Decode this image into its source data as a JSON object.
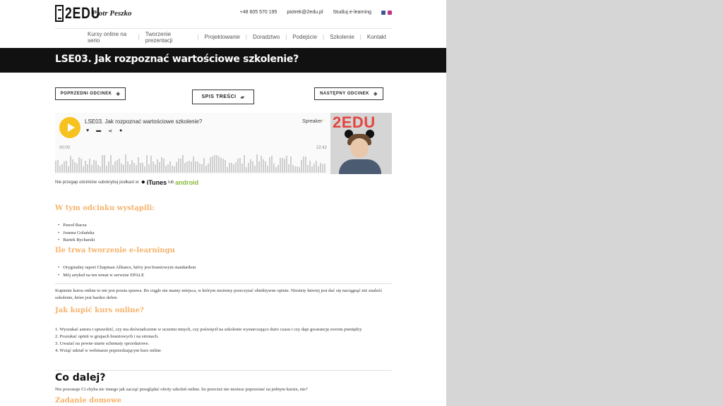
{
  "header": {
    "logo": "2EDU",
    "author": "Piotr Peszko",
    "phone": "+48 605 570 195",
    "email": "piotrek@2edu.pl",
    "study_link": "Studiuj e-learning"
  },
  "nav": [
    "Kursy online na serio",
    "Tworzenie prezentacji",
    "Projektowanie",
    "Doradztwo",
    "Podejście",
    "Szkolenie",
    "Kontakt"
  ],
  "page_title": "LSE03. Jak rozpoznać wartościowe szkolenie?",
  "buttons": {
    "prev": "POPRZEDNI ODCINEK",
    "toc": "SPIS TREŚCI",
    "next": "NASTĘPNY ODCINEK"
  },
  "player": {
    "title": "LSE03. Jak rozpoznać wartościowe szkolenie?",
    "provider": "Spreaker",
    "time_start": "00:00",
    "time_end": "22:42",
    "cover_brand": "2EDU"
  },
  "subscribe": {
    "text": "Nie przegap odcinków subskrybuj podkast w:",
    "itunes": "iTunes",
    "or": "lub",
    "android": "android"
  },
  "sections": {
    "guests_heading": "W tym odcinku wystąpili:",
    "guests": [
      "Paweł Bacza",
      "Joanna Golańska",
      "Bartek Rycharski"
    ],
    "time_heading": "Ile trwa tworzenie e-learningu",
    "time_items": [
      "Oryginalny raport Chapman Alliance, który jest branżowym standardem",
      "Mój artykuł na ten temat w serwisie EPALE"
    ],
    "intro_para": "Kupienie kursu online to nie jest prosta sprawa. Bo ciągle nie mamy miejsca, w którym możemy przeczytać obiektywne opinie. Niestety łatwiej jest dać się naciągnąć niż znaleźć szkolenie, które jest bardzo dobre.",
    "buy_heading": "Jak kupić kurs online?",
    "buy_steps": [
      "1. Wyszukać autora i sprawdzić, czy ma doświadczenie w uczeniu innych, czy poświęcił na szkolenie wystarczająco dużo czasu i czy daje gwarancję zwrotu pieniędzy",
      "2. Poszukać opinii w grupach branżowych i na stronach.",
      "3. Uważać na pewne utarte schematy sprzedażowe.",
      "4. Wziąć udział w webinarze poprzedzającym kurs online"
    ],
    "next_heading": "Co dalej?",
    "next_para": "Nie pozostaje Ci chyba nic innego jak zacząć przeglądać oferty szkoleń online. bo przecież nie możesz poprzestać na jednym kursie, nie?",
    "homework_heading": "Zadanie domowe"
  },
  "colors": {
    "accent_orange": "#f5b26b",
    "play_yellow": "#f7c21e",
    "title_bar": "#111111",
    "android_green": "#8cb93a"
  }
}
